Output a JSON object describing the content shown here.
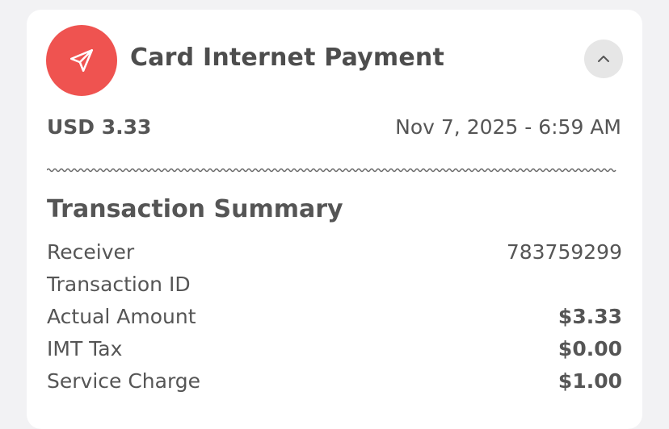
{
  "header": {
    "title": "Card Internet Payment",
    "icon": "send-icon",
    "collapse_icon": "chevron-up-icon",
    "accent_color": "#ef5350"
  },
  "overview": {
    "amount": "USD 3.33",
    "datetime": "Nov 7, 2025 - 6:59 AM"
  },
  "summary": {
    "title": "Transaction Summary",
    "rows": [
      {
        "label": "Receiver",
        "value": "783759299"
      },
      {
        "label": "Transaction ID",
        "value": ""
      },
      {
        "label": "Actual Amount",
        "value": "$3.33"
      },
      {
        "label": "IMT Tax",
        "value": "$0.00"
      },
      {
        "label": "Service Charge",
        "value": "$1.00"
      }
    ]
  }
}
